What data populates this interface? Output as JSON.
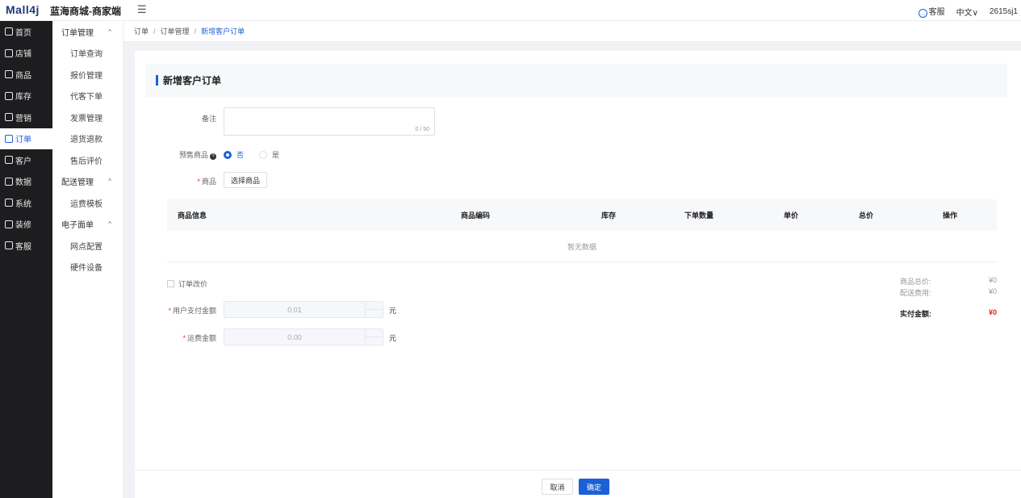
{
  "header": {
    "logo": "Mall4j",
    "shop_name": "蓝海商城-商家端",
    "menu_toggle": "☰",
    "service": "客服",
    "language": "中文∨",
    "user": "2615sj1"
  },
  "sidebar": {
    "items": [
      {
        "label": "首页",
        "icon": "home-icon"
      },
      {
        "label": "店铺",
        "icon": "shop-icon"
      },
      {
        "label": "商品",
        "icon": "product-icon"
      },
      {
        "label": "库存",
        "icon": "inventory-icon"
      },
      {
        "label": "营销",
        "icon": "gift-icon"
      },
      {
        "label": "订单",
        "icon": "order-icon"
      },
      {
        "label": "客户",
        "icon": "customer-icon"
      },
      {
        "label": "数据",
        "icon": "data-icon"
      },
      {
        "label": "系统",
        "icon": "settings-icon"
      },
      {
        "label": "装修",
        "icon": "decorate-icon"
      },
      {
        "label": "客服",
        "icon": "chat-icon"
      }
    ]
  },
  "submenu": {
    "group1": "订单管理",
    "group1_items": [
      "订单查询",
      "报价管理",
      "代客下单",
      "发票管理",
      "退货退款",
      "售后评价"
    ],
    "group2": "配送管理",
    "group2_items": [
      "运费模板"
    ],
    "group3": "电子面单",
    "group3_items": [
      "网点配置",
      "硬件设备"
    ]
  },
  "breadcrumb": {
    "level1": "订单",
    "level2": "订单管理",
    "level3": "新增客户订单",
    "separator": "/"
  },
  "form": {
    "title": "新增客户订单",
    "remark_label": "备注",
    "remark_count": "0 / 50",
    "presale_label": "预售商品",
    "presale_no": "否",
    "presale_yes": "是",
    "product_label": "商品",
    "select_product": "选择商品",
    "required_mark": "*"
  },
  "table": {
    "columns": [
      "商品信息",
      "商品编码",
      "库存",
      "下单数量",
      "单价",
      "总价",
      "操作"
    ],
    "empty": "暂无数据"
  },
  "pricing": {
    "change_price": "订单改价",
    "user_pay_label": "用户支付金额",
    "user_pay_value": "0.01",
    "shipping_label": "运费金额",
    "shipping_value": "0.00",
    "unit": "元",
    "product_total_label": "商品总价:",
    "product_total_value": "¥0",
    "shipping_fee_label": "配送费用:",
    "shipping_fee_value": "¥0",
    "actual_label": "实付金额:",
    "actual_value": "¥0"
  },
  "footer": {
    "cancel": "取消",
    "confirm": "确定"
  },
  "colors": {
    "primary": "#1c60d8",
    "sidebar_bg": "#1d1d1f",
    "price_red": "#e02020"
  }
}
